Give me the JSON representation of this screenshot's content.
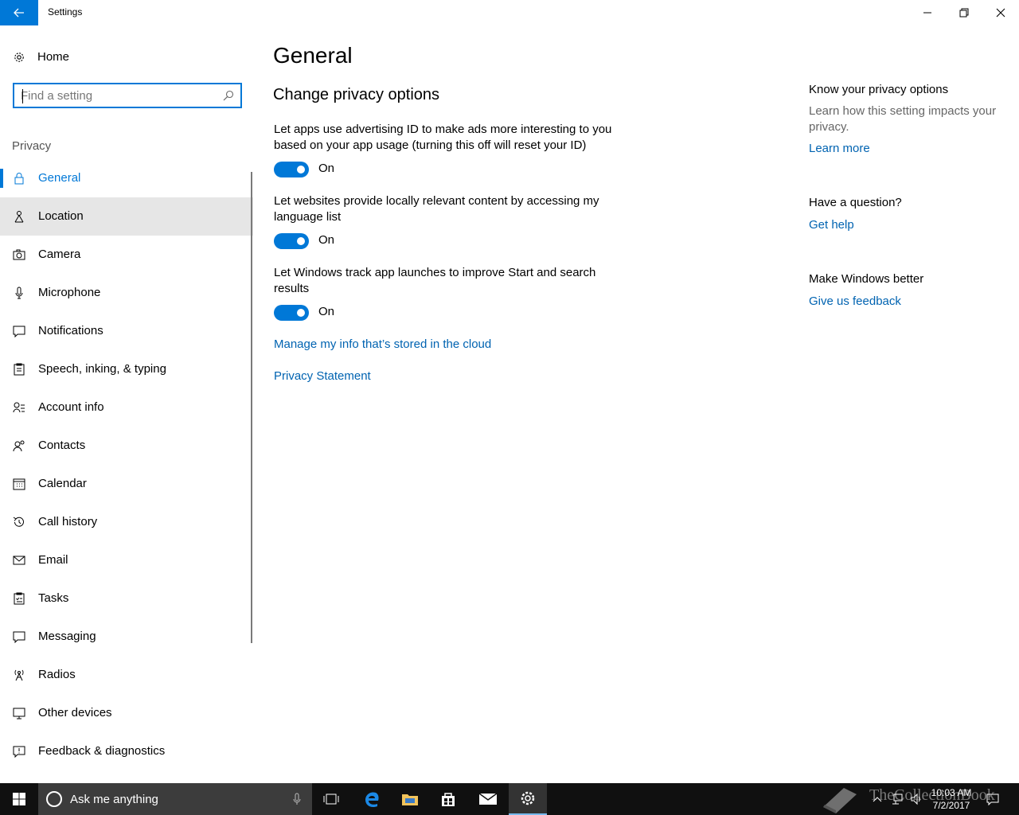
{
  "window": {
    "title": "Settings"
  },
  "sidebar": {
    "home_label": "Home",
    "search_placeholder": "Find a setting",
    "section_label": "Privacy",
    "items": [
      {
        "label": "General",
        "icon": "lock-icon",
        "selected": true
      },
      {
        "label": "Location",
        "icon": "location-icon"
      },
      {
        "label": "Camera",
        "icon": "camera-icon"
      },
      {
        "label": "Microphone",
        "icon": "microphone-icon"
      },
      {
        "label": "Notifications",
        "icon": "notification-icon"
      },
      {
        "label": "Speech, inking, & typing",
        "icon": "clipboard-icon"
      },
      {
        "label": "Account info",
        "icon": "account-icon"
      },
      {
        "label": "Contacts",
        "icon": "contacts-icon"
      },
      {
        "label": "Calendar",
        "icon": "calendar-icon"
      },
      {
        "label": "Call history",
        "icon": "history-icon"
      },
      {
        "label": "Email",
        "icon": "mail-icon"
      },
      {
        "label": "Tasks",
        "icon": "tasks-icon"
      },
      {
        "label": "Messaging",
        "icon": "message-icon"
      },
      {
        "label": "Radios",
        "icon": "radio-icon"
      },
      {
        "label": "Other devices",
        "icon": "devices-icon"
      },
      {
        "label": "Feedback & diagnostics",
        "icon": "feedback-icon"
      }
    ]
  },
  "main": {
    "title": "General",
    "subtitle": "Change privacy options",
    "settings": [
      {
        "description": "Let apps use advertising ID to make ads more interesting to you based on your app usage (turning this off will reset your ID)",
        "state": "On"
      },
      {
        "description": "Let websites provide locally relevant content by accessing my language list",
        "state": "On"
      },
      {
        "description": "Let Windows track app launches to improve Start and search results",
        "state": "On"
      }
    ],
    "links": {
      "manage_cloud": "Manage my info that’s stored in the cloud",
      "privacy_statement": "Privacy Statement"
    }
  },
  "right_panel": {
    "know_heading": "Know your privacy options",
    "know_text": "Learn how this setting impacts your privacy.",
    "learn_more": "Learn more",
    "question_heading": "Have a question?",
    "get_help": "Get help",
    "better_heading": "Make Windows better",
    "feedback_link": "Give us feedback"
  },
  "taskbar": {
    "search_text": "Ask me anything",
    "time": "10:03 AM",
    "date": "7/2/2017",
    "watermark": "TheCollectionBook"
  },
  "colors": {
    "accent": "#0078d7",
    "link": "#0063b1",
    "taskbar": "#101010"
  }
}
